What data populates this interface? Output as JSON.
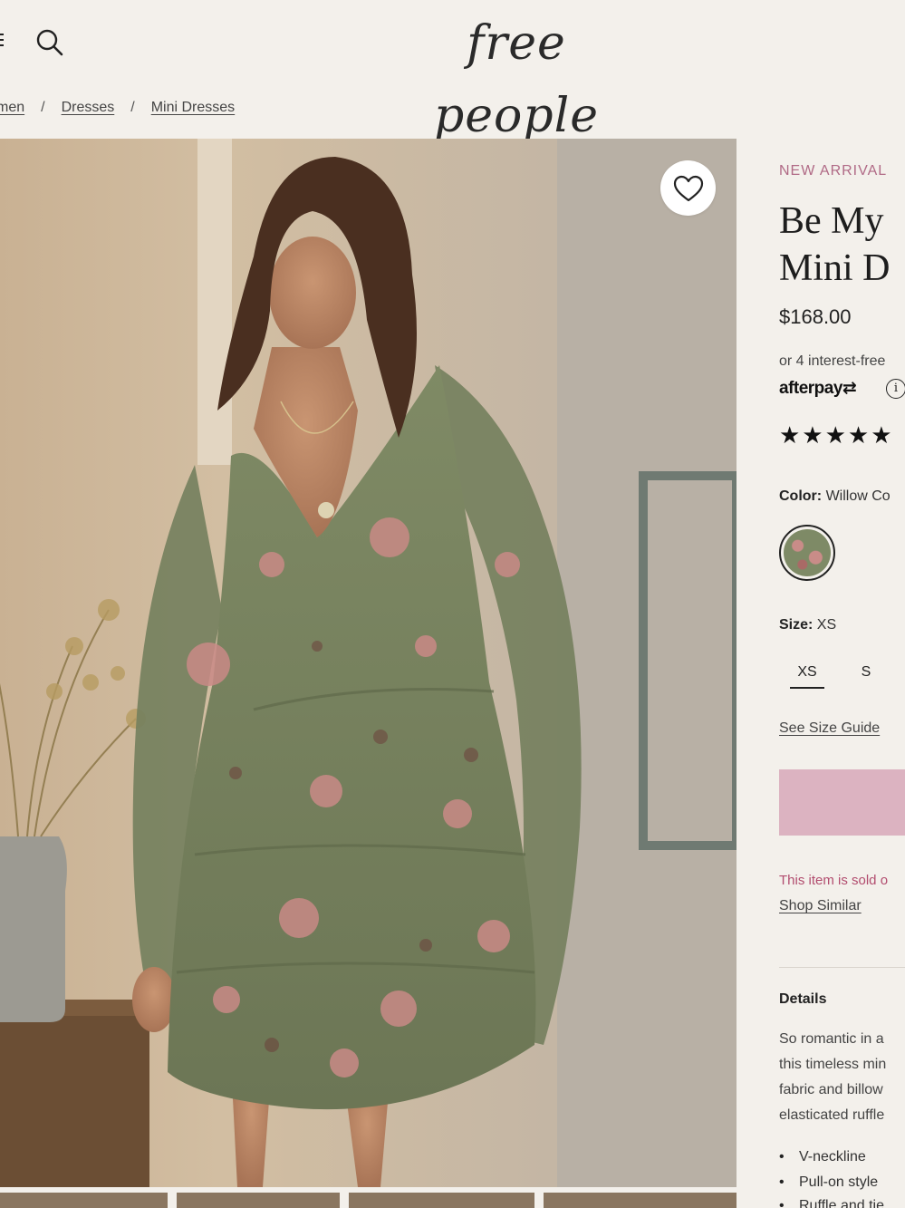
{
  "header": {
    "logo_text": "free people"
  },
  "breadcrumb": {
    "items": [
      "men",
      "Dresses",
      "Mini Dresses"
    ],
    "separator": "/"
  },
  "product": {
    "badge": "NEW ARRIVAL",
    "title_line1": "Be My",
    "title_line2": "Mini D",
    "price": "$168.00",
    "installments": "or 4 interest-free",
    "afterpay": "afterpay",
    "stars": "★★★★★",
    "color_label": "Color:",
    "color_value": "Willow Co",
    "size_label": "Size:",
    "size_value": "XS",
    "sizes": [
      "XS",
      "S"
    ],
    "size_guide": "See Size Guide",
    "sold_out": "This item is sold o",
    "shop_similar": "Shop Similar"
  },
  "details": {
    "heading": "Details",
    "lines": [
      "So romantic in a",
      "this timeless min",
      "fabric and billow",
      "elasticated ruffle"
    ],
    "bullets": [
      "V-neckline",
      "Pull-on style",
      "Ruffle and tie"
    ]
  },
  "colors": {
    "accent_pink": "#b06a86",
    "button_pink": "#dcb3c1",
    "background": "#f3f0eb"
  }
}
